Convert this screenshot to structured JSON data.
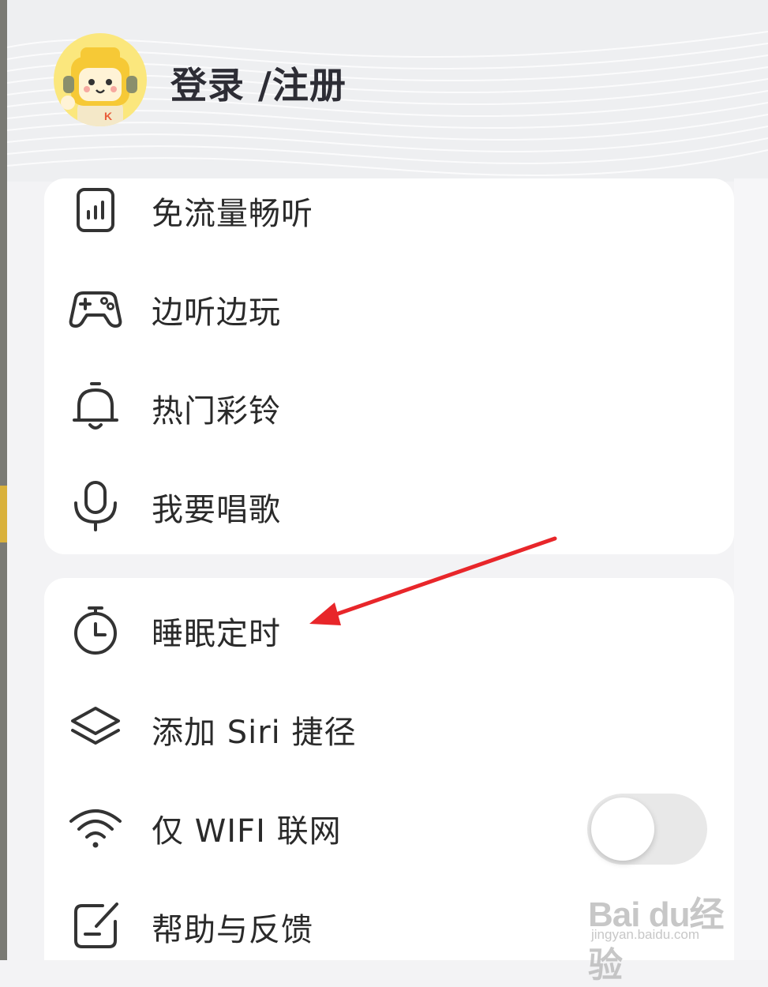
{
  "header": {
    "login_label": "登录 /注册"
  },
  "menu_group_1": [
    {
      "label": "免流量畅听",
      "icon": "data-plan-icon"
    },
    {
      "label": "边听边玩",
      "icon": "gamepad-icon"
    },
    {
      "label": "热门彩铃",
      "icon": "bell-icon"
    },
    {
      "label": "我要唱歌",
      "icon": "microphone-icon"
    }
  ],
  "menu_group_2": [
    {
      "label": "睡眠定时",
      "icon": "timer-icon"
    },
    {
      "label": "添加 Siri 捷径",
      "icon": "layers-icon"
    },
    {
      "label": "仅 WIFI 联网",
      "icon": "wifi-icon",
      "toggle_on": false
    },
    {
      "label": "帮助与反馈",
      "icon": "feedback-icon"
    }
  ],
  "watermark": {
    "brand": "Bai du经验",
    "site": "jingyan.baidu.com"
  },
  "colors": {
    "annotation_arrow": "#e8262a",
    "avatar_bg": "#fbe77d",
    "toggle_off_bg": "#e8e8e8"
  }
}
